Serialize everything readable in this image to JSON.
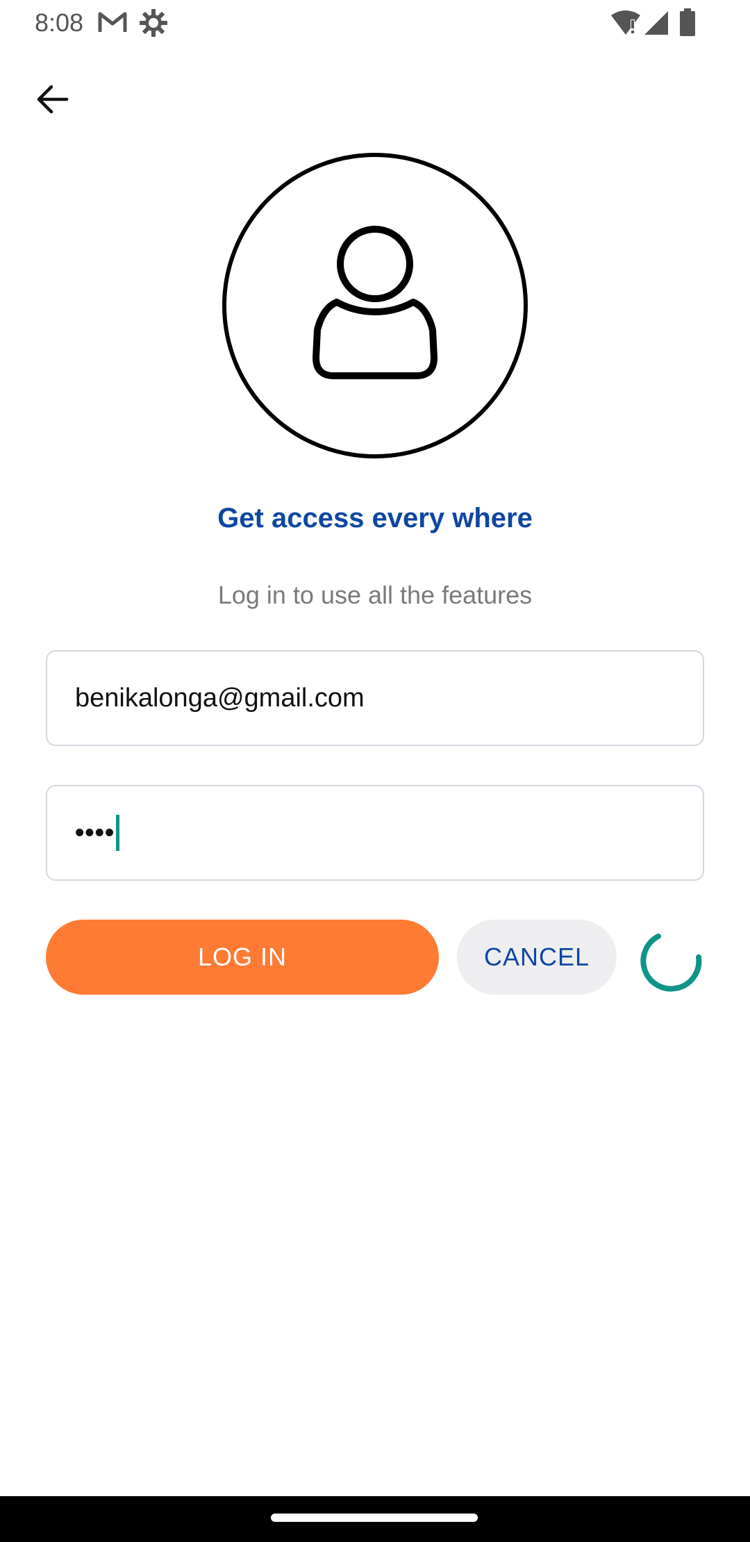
{
  "status_bar": {
    "time": "8:08",
    "left_icons": [
      "gmail-icon",
      "settings-gear-icon"
    ],
    "right_icons": [
      "wifi-alert-icon",
      "cell-signal-icon",
      "battery-icon"
    ]
  },
  "app_bar": {
    "back_icon": "arrow-back-icon"
  },
  "avatar": {
    "icon": "user-icon"
  },
  "headline": "Get access every where",
  "subline": "Log in to use all the features",
  "form": {
    "email_value": "benikalonga@gmail.com",
    "password_masked": "••••"
  },
  "buttons": {
    "login_label": "LOG IN",
    "cancel_label": "CANCEL"
  },
  "colors": {
    "primary_blue": "#0e47a1",
    "login_orange": "#ff7a33",
    "accent_teal": "#0e9488",
    "subtext_gray": "#7a7a7a"
  }
}
